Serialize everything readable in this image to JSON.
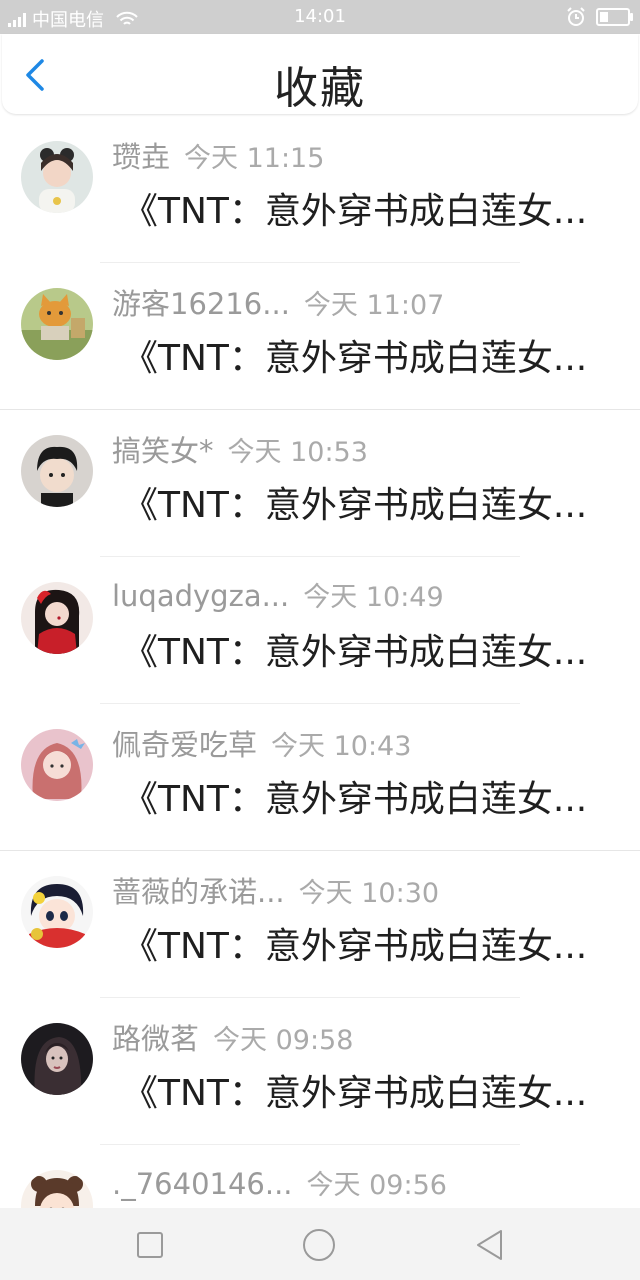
{
  "status_bar": {
    "carrier": "中国电信",
    "time": "14:01",
    "battery_level": 0.3
  },
  "header": {
    "title": "收藏",
    "back_icon": "chevron-left-icon"
  },
  "colors": {
    "accent": "#1e88e5",
    "status_bar_bg": "#cfcfcf",
    "name_text": "#9a9a9a",
    "title_text": "#1f1f1f"
  },
  "favorites": [
    {
      "name": "瓒垚",
      "time": "今天 11:15",
      "title": "《TNT：意外穿书成白莲女...",
      "avatar": "avatar-girl-bunny-ears"
    },
    {
      "name": "游客16216...",
      "time": "今天 11:07",
      "title": "《TNT：意外穿书成白莲女...",
      "avatar": "avatar-cat-drawing"
    },
    {
      "name": "搞笑女*",
      "time": "今天 10:53",
      "title": "《TNT：意外穿书成白莲女...",
      "avatar": "avatar-boy-portrait"
    },
    {
      "name": "luqadygza...",
      "time": "今天 10:49",
      "title": "《TNT：意外穿书成白莲女...",
      "avatar": "avatar-woman-red"
    },
    {
      "name": "佩奇爱吃草",
      "time": "今天 10:43",
      "title": "《TNT：意外穿书成白莲女...",
      "avatar": "avatar-girl-pink-hair"
    },
    {
      "name": "蔷薇的承诺...",
      "time": "今天 10:30",
      "title": "《TNT：意外穿书成白莲女...",
      "avatar": "avatar-cartoon-girl"
    },
    {
      "name": "路微茗",
      "time": "今天 09:58",
      "title": "《TNT：意外穿书成白莲女...",
      "avatar": "avatar-dark-hair-girl"
    },
    {
      "name": "._7640146...",
      "time": "今天 09:56",
      "title": "",
      "avatar": "avatar-chibi-girl"
    }
  ],
  "nav": {
    "recent_icon": "square-icon",
    "home_icon": "circle-icon",
    "back_icon": "triangle-back-icon"
  }
}
